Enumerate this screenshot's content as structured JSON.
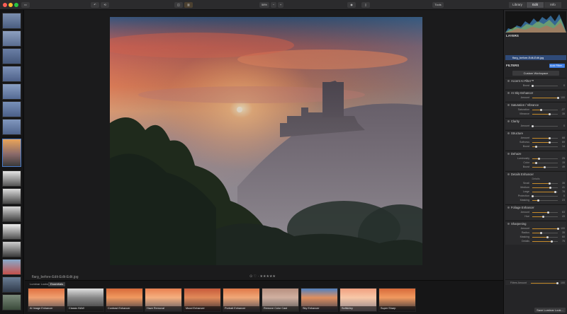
{
  "toolbar": {
    "zoom": "58%",
    "tools_label": "Tools",
    "tabs": [
      "Library",
      "Edit",
      "Info"
    ],
    "active_tab": "Edit"
  },
  "file_name": "flarg_before-Edit-Edit-Edit.jpg",
  "rating": "⊙ ♡ · ★★★★★",
  "looks": {
    "tabs": [
      "Luminar Looks",
      "Essentials"
    ],
    "items": [
      "AI Image Enhancer",
      "Classic B&W",
      "Contrast Enhancer",
      "Haze Removal",
      "Mood Enhancer",
      "Portrait Enhancer",
      "Remove Color Cast",
      "Sky Enhancer",
      "Soft&Airy",
      "Super Sharp"
    ]
  },
  "panel": {
    "layers_title": "LAYERS",
    "layer_name": "flarg_before-Edit-Edit.jpg",
    "filters_title": "FILTERS",
    "add_filter": "Add Filter...",
    "workspace": "Custom Workspace",
    "sections": [
      {
        "name": "Accent AI Filter™",
        "rows": [
          {
            "n": "Boost",
            "v": 0,
            "p": 0.0
          }
        ]
      },
      {
        "name": "AI Sky Enhancer",
        "rows": [
          {
            "n": "Amount",
            "v": 100,
            "p": 1.0
          }
        ]
      },
      {
        "name": "Saturation / Vibrance",
        "rows": [
          {
            "n": "Saturation",
            "v": -27,
            "p": 0.36
          },
          {
            "n": "Vibrance",
            "v": 35,
            "p": 0.68
          }
        ]
      },
      {
        "name": "Clarity",
        "rows": [
          {
            "n": "Amount",
            "v": 0,
            "p": 0.0
          }
        ]
      },
      {
        "name": "Structure",
        "rows": [
          {
            "n": "Amount",
            "v": 68,
            "p": 0.68
          },
          {
            "n": "Softness",
            "v": 69,
            "p": 0.69
          },
          {
            "n": "Boost",
            "v": 14,
            "p": 0.14
          }
        ]
      },
      {
        "name": "Dehaze",
        "rows": [
          {
            "n": "Luminosity",
            "v": 25,
            "p": 0.25
          },
          {
            "n": "Color",
            "v": 15,
            "p": 0.15
          },
          {
            "n": "Boost",
            "v": 49,
            "p": 0.49
          }
        ]
      },
      {
        "name": "Details Enhancer",
        "sub": "Details",
        "rows": [
          {
            "n": "Small",
            "v": 35,
            "p": 0.67
          },
          {
            "n": "Medium",
            "v": 41,
            "p": 0.7
          },
          {
            "n": "Large",
            "v": 78,
            "p": 0.89
          },
          {
            "n": "Protection",
            "v": 0,
            "p": 0.0
          },
          {
            "n": "Masking",
            "v": 23,
            "p": 0.23
          }
        ]
      },
      {
        "name": "Foliage Enhancer",
        "rows": [
          {
            "n": "Amount",
            "v": 63,
            "p": 0.63
          },
          {
            "n": "Hue",
            "v": 43,
            "p": 0.43
          }
        ]
      },
      {
        "name": "Sharpening",
        "rows": [
          {
            "n": "Amount",
            "v": 100,
            "p": 1.0
          },
          {
            "n": "Radius",
            "v": 35,
            "p": 0.35
          },
          {
            "n": "Masking",
            "v": 60,
            "p": 0.6
          },
          {
            "n": "Details",
            "v": 75,
            "p": 0.75
          }
        ]
      }
    ],
    "filters_amount_label": "Filters Amount",
    "filters_amount": 100,
    "save_look": "Save Luminar Look..."
  },
  "colors": {
    "accent": "#3c7be0",
    "slider": "#c58a2a",
    "panel": "#252527"
  }
}
